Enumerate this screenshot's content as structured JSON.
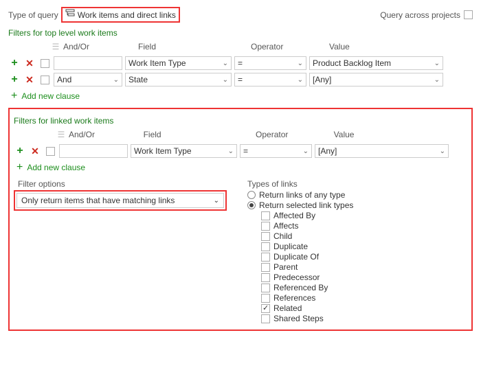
{
  "top": {
    "type_label": "Type of query",
    "query_type": "Work items and direct links",
    "across_label": "Query across projects"
  },
  "headers": {
    "andor": "And/Or",
    "field": "Field",
    "operator": "Operator",
    "value": "Value"
  },
  "topFilters": {
    "title": "Filters for top level work items",
    "rows": [
      {
        "andor": "",
        "field": "Work Item Type",
        "op": "=",
        "val": "Product Backlog Item"
      },
      {
        "andor": "And",
        "field": "State",
        "op": "=",
        "val": "[Any]"
      }
    ],
    "add": "Add new clause"
  },
  "linkedFilters": {
    "title": "Filters for linked work items",
    "rows": [
      {
        "andor": "",
        "field": "Work Item Type",
        "op": "=",
        "val": "[Any]"
      }
    ],
    "add": "Add new clause"
  },
  "filterOptions": {
    "label": "Filter options",
    "selected": "Only return items that have matching links"
  },
  "linkTypes": {
    "label": "Types of links",
    "any": "Return links of any type",
    "selected": "Return selected link types",
    "items": [
      {
        "name": "Affected By",
        "checked": false
      },
      {
        "name": "Affects",
        "checked": false
      },
      {
        "name": "Child",
        "checked": false
      },
      {
        "name": "Duplicate",
        "checked": false
      },
      {
        "name": "Duplicate Of",
        "checked": false
      },
      {
        "name": "Parent",
        "checked": false
      },
      {
        "name": "Predecessor",
        "checked": false
      },
      {
        "name": "Referenced By",
        "checked": false
      },
      {
        "name": "References",
        "checked": false
      },
      {
        "name": "Related",
        "checked": true
      },
      {
        "name": "Shared Steps",
        "checked": false
      }
    ]
  }
}
